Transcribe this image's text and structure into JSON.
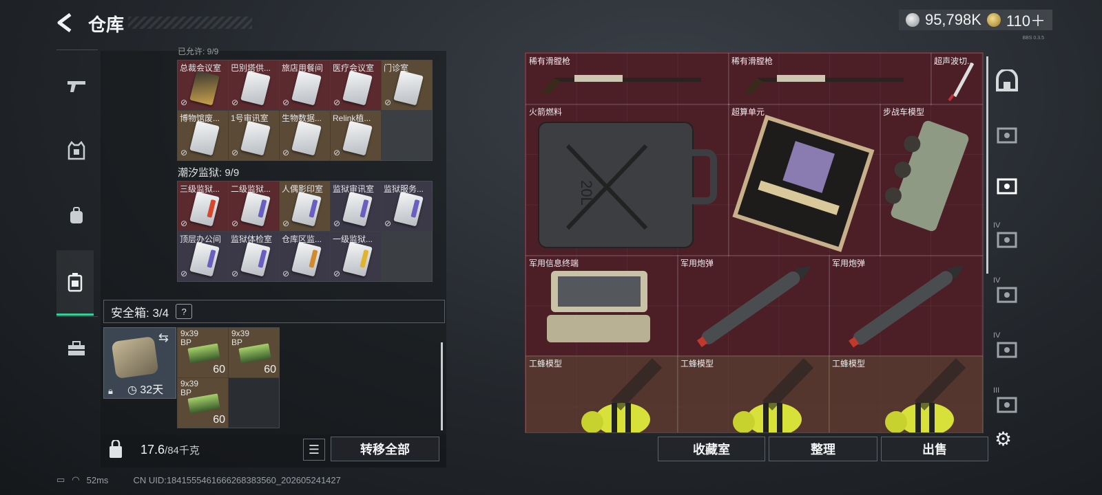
{
  "header": {
    "title": "仓库",
    "currency_silver": "95,798K",
    "currency_gold": "110＋",
    "version": "BBS 0.3.5"
  },
  "left_sidebar": {
    "tabs": [
      "weapon-icon",
      "armor-icon",
      "backpack-icon",
      "storage-icon",
      "toolbox-icon"
    ],
    "active_tab": 3
  },
  "keycards": {
    "partial_header": "已允许: 9/9",
    "group1": [
      {
        "name": "总裁会议室",
        "color": "red",
        "card": "dark"
      },
      {
        "name": "巴别塔供...",
        "color": "red",
        "card": "light"
      },
      {
        "name": "旅店用餐间",
        "color": "red",
        "card": "light"
      },
      {
        "name": "医疗会议室",
        "color": "red",
        "card": "light"
      },
      {
        "name": "门诊室",
        "color": "gold",
        "card": "light"
      },
      {
        "name": "博物馆废...",
        "color": "gold",
        "card": "light"
      },
      {
        "name": "1号审讯室",
        "color": "gold",
        "card": "light"
      },
      {
        "name": "生物数据...",
        "color": "gold",
        "card": "light"
      },
      {
        "name": "Relink植...",
        "color": "gold",
        "card": "light"
      }
    ],
    "group2_label": "潮汐监狱: 9/9",
    "group2": [
      {
        "name": "三级监狱...",
        "color": "red",
        "stripe": "#d7472c"
      },
      {
        "name": "二级监狱...",
        "color": "red",
        "stripe": "#6a5fc0"
      },
      {
        "name": "人偶影印室",
        "color": "gold",
        "stripe": "#6a5fc0"
      },
      {
        "name": "监狱审讯室",
        "color": "purple",
        "stripe": "#6a5fc0"
      },
      {
        "name": "监狱服务...",
        "color": "purple",
        "stripe": "#6a5fc0"
      },
      {
        "name": "顶层办公间",
        "color": "purple",
        "stripe": "#6a5fc0"
      },
      {
        "name": "监狱体检室",
        "color": "purple",
        "stripe": "#6a5fc0"
      },
      {
        "name": "仓库区监...",
        "color": "purple",
        "stripe": "#d08c2c"
      },
      {
        "name": "一级监狱...",
        "color": "purple",
        "stripe": "#e0b42c"
      }
    ]
  },
  "safe": {
    "label": "安全箱: 3/4",
    "help": "?",
    "timer": "32天",
    "ammo": [
      {
        "name": "9x39\nBP",
        "count": "60"
      },
      {
        "name": "9x39\nBP",
        "count": "60"
      },
      {
        "name": "9x39\nBP",
        "count": "60"
      }
    ]
  },
  "bottom_left": {
    "weight": "17.6",
    "weight_max": "/84千克",
    "transfer_all": "转移全部"
  },
  "status_bar": {
    "ping": "52ms",
    "uid": "CN UID:1841555461666268383560_202605241427"
  },
  "storage_items": [
    {
      "name": "稀有滑膛枪",
      "kind": "rifle"
    },
    {
      "name": "稀有滑膛枪",
      "kind": "rifle"
    },
    {
      "name": "超声波切...",
      "kind": "tool"
    },
    {
      "name": "火箭燃料",
      "kind": "jerrycan"
    },
    {
      "name": "超算单元",
      "kind": "board"
    },
    {
      "name": "步战车模型",
      "kind": "vehicle"
    },
    {
      "name": "军用信息终端",
      "kind": "terminal"
    },
    {
      "name": "军用炮弹",
      "kind": "shell"
    },
    {
      "name": "军用炮弹",
      "kind": "shell"
    },
    {
      "name": "工蜂模型",
      "kind": "bee"
    },
    {
      "name": "工蜂模型",
      "kind": "bee"
    },
    {
      "name": "工蜂模型",
      "kind": "bee"
    }
  ],
  "jerrycan_text": "20L",
  "right_actions": {
    "collection": "收藏室",
    "organize": "整理",
    "sell": "出售"
  },
  "right_sidebar": [
    "vault-icon",
    "shelf-icon",
    "shelf-icon",
    "shelf-icon",
    "shelf-icon",
    "shelf-icon",
    "shelf-icon"
  ],
  "right_sidebar_marks": [
    "IV",
    "IV",
    "IV",
    "III"
  ],
  "colors": {
    "accent": "#2fd39a",
    "rare_red": "#5b2a2f",
    "epic_gold": "#5a4a36",
    "purple": "#3b3847"
  }
}
